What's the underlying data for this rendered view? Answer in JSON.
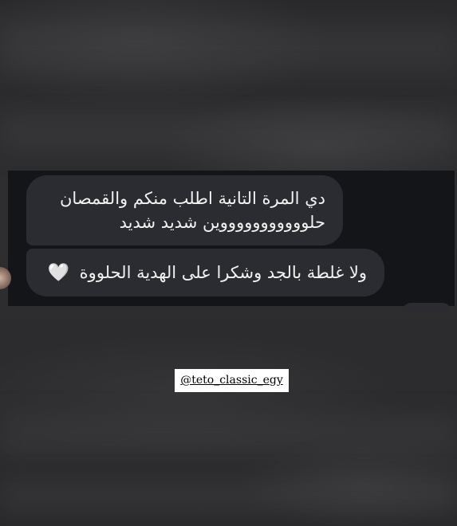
{
  "chat": {
    "messages": [
      {
        "line1": "دي المرة التانية اطلب منكم والقمصان",
        "line2": "حلوووووووووووين شديد شديد"
      },
      {
        "text": "ولا غلطة بالجد وشكرا على الهدية الحلووة",
        "emoji": "🤍"
      }
    ]
  },
  "story": {
    "mention": "@teto_classic_egy"
  },
  "colors": {
    "bubble": "#2b2c31",
    "panel": "#141519",
    "background": "#2b2b2d",
    "sticker": "#ffffff"
  }
}
